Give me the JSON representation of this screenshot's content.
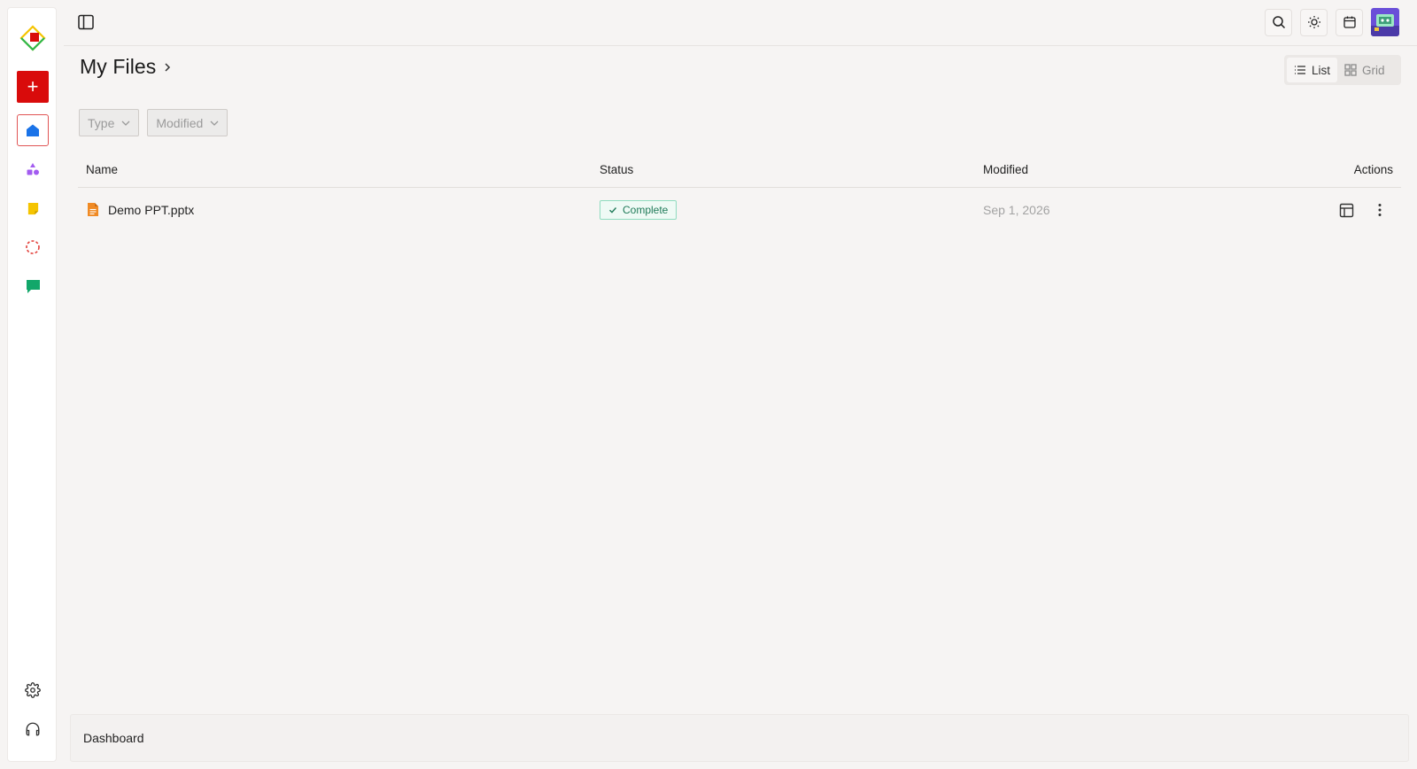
{
  "colors": {
    "accent_red": "#d90b0b",
    "home_blue": "#1a73e8",
    "apps_purple": "#a35cf0",
    "notes_yellow": "#f5c400",
    "activity_red": "#e2413c",
    "chat_green": "#12a76a",
    "status_complete": "#1f7a58",
    "file_orange": "#f08a24"
  },
  "sidebar": {
    "items": [
      {
        "icon": "logo-icon"
      },
      {
        "icon": "plus-icon",
        "label": "+"
      },
      {
        "icon": "home-icon"
      },
      {
        "icon": "shapes-icon"
      },
      {
        "icon": "note-icon"
      },
      {
        "icon": "dashed-circle-icon"
      },
      {
        "icon": "chat-bubble-icon"
      },
      {
        "icon": "gear-icon"
      },
      {
        "icon": "headset-icon"
      }
    ]
  },
  "header": {
    "title": "My Files",
    "icons": [
      "panel-toggle-icon",
      "search-icon",
      "sun-icon",
      "calendar-icon",
      "avatar"
    ]
  },
  "view_toggle": {
    "list_label": "List",
    "grid_label": "Grid",
    "active": "list"
  },
  "filters": [
    {
      "label": "Type"
    },
    {
      "label": "Modified"
    }
  ],
  "table": {
    "columns": [
      "Name",
      "Status",
      "Modified",
      "Actions"
    ],
    "rows": [
      {
        "name": "Demo PPT.pptx",
        "status": "Complete",
        "modified": "Sep 1, 2026"
      }
    ]
  },
  "footer": {
    "label": "Dashboard"
  }
}
